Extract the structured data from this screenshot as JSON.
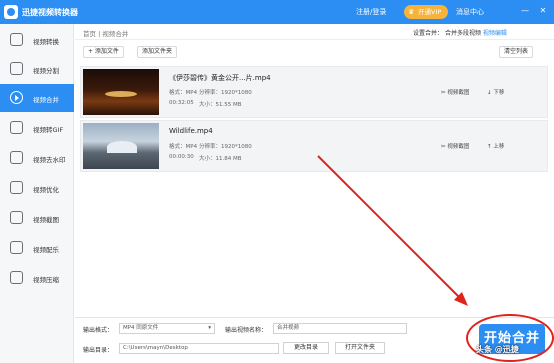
{
  "app": {
    "title": "迅捷视频转换器"
  },
  "titlebar": {
    "login_label": "注册/登录",
    "vip_label": "开通VIP",
    "msg_center_label": "消息中心",
    "minimize": "—",
    "close": "✕"
  },
  "sidebar": {
    "items": [
      {
        "label": "视频转换",
        "icon": "video-convert-icon"
      },
      {
        "label": "视频分割",
        "icon": "video-split-icon"
      },
      {
        "label": "视频合并",
        "icon": "video-merge-icon",
        "active": true
      },
      {
        "label": "视频转GIF",
        "icon": "gif-icon"
      },
      {
        "label": "视频去水印",
        "icon": "watermark-remove-icon"
      },
      {
        "label": "视频优化",
        "icon": "video-optimize-icon"
      },
      {
        "label": "视频截图",
        "icon": "screenshot-icon"
      },
      {
        "label": "视频配乐",
        "icon": "music-icon"
      },
      {
        "label": "视频压缩",
        "icon": "compress-icon"
      }
    ]
  },
  "breadcrumb": {
    "home": "首页",
    "sep": "|",
    "current": "视频合并"
  },
  "merge_setting": {
    "label": "设置合并：",
    "value": "合并多段视频",
    "action": "视频编辑"
  },
  "toolbar": {
    "add_file": "+ 添加文件",
    "add_folder": "添加文件夹",
    "clear_list": "清空列表"
  },
  "files": [
    {
      "name": "《伊莎碧传》黄金公开...片.mp4",
      "format_label": "格式：",
      "format": "MP4",
      "resolution_label": "分辨率：",
      "resolution": "1920*1080",
      "duration": "00:32:05",
      "size_label": "大小：",
      "size": "51.55 MB",
      "edit_label": "视频截图",
      "move_label": "下移"
    },
    {
      "name": "Wildlife.mp4",
      "format_label": "格式：",
      "format": "MP4",
      "resolution_label": "分辨率：",
      "resolution": "1920*1080",
      "duration": "00:00:30",
      "size_label": "大小：",
      "size": "11.84 MB",
      "edit_label": "视频截图",
      "move_label": "上移"
    }
  ],
  "output": {
    "format_label": "输出格式：",
    "format_value": "MP4 同原文件",
    "name_label": "输出视频名称：",
    "name_value": "合并视频",
    "dir_label": "输出目录：",
    "dir_value": "C:\\Users\\mayn\\Desktop",
    "change_dir": "更改目录",
    "open_folder": "打开文件夹",
    "start_label": "开始合并"
  },
  "watermark": "头条 @迅捷",
  "colors": {
    "accent": "#2c8df2",
    "annotation": "#e0231c",
    "vip": "#f5b33a"
  }
}
